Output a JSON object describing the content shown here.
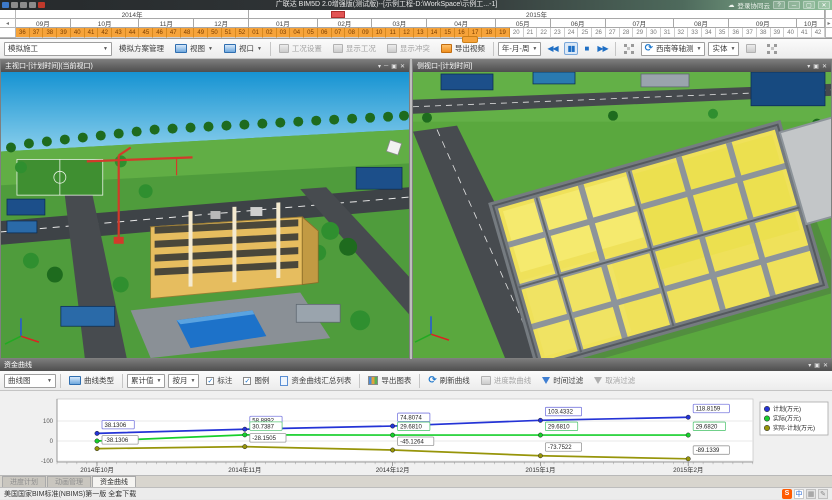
{
  "window": {
    "title": "广联达 BIM5D 2.0增强版(测试版)--[示例工程-D:\\WorkSpace\\示例工...-1]",
    "login_label": "登录协同云"
  },
  "timeline": {
    "years": [
      {
        "label": "2014年",
        "weeks": 17
      },
      {
        "label": "2015年",
        "weeks": 42
      }
    ],
    "months": [
      {
        "label": "09月",
        "weeks": 4
      },
      {
        "label": "10月",
        "weeks": 5
      },
      {
        "label": "11月",
        "weeks": 4
      },
      {
        "label": "12月",
        "weeks": 4
      },
      {
        "label": "01月",
        "weeks": 5
      },
      {
        "label": "02月",
        "weeks": 4
      },
      {
        "label": "03月",
        "weeks": 4
      },
      {
        "label": "04月",
        "weeks": 5
      },
      {
        "label": "05月",
        "weeks": 4
      },
      {
        "label": "06月",
        "weeks": 4
      },
      {
        "label": "07月",
        "weeks": 5
      },
      {
        "label": "08月",
        "weeks": 4
      },
      {
        "label": "09月",
        "weeks": 5
      },
      {
        "label": "10月",
        "weeks": 2
      }
    ],
    "weeks": [
      "36",
      "37",
      "38",
      "39",
      "40",
      "41",
      "42",
      "43",
      "44",
      "45",
      "46",
      "47",
      "48",
      "49",
      "50",
      "51",
      "52",
      "01",
      "02",
      "03",
      "04",
      "05",
      "06",
      "07",
      "08",
      "09",
      "10",
      "11",
      "12",
      "13",
      "14",
      "15",
      "16",
      "17",
      "18",
      "19",
      "20",
      "21",
      "22",
      "23",
      "24",
      "25",
      "26",
      "27",
      "28",
      "29",
      "30",
      "31",
      "32",
      "33",
      "34",
      "35",
      "36",
      "37",
      "38",
      "39",
      "40",
      "41",
      "42"
    ],
    "highlighted_count": 36,
    "current_marker_week_index": 23,
    "highlight_color": "#f6a33a"
  },
  "sim_toolbar": {
    "scheme_combo": "模拟施工",
    "manage_button": "模拟方案管理",
    "view_button": "视图",
    "viewport_button": "视口",
    "condition_button": "工况设置",
    "show_condition_button": "显示工况",
    "show_conflict_button": "显示冲突",
    "export_video_button": "导出视频",
    "granularity_combo": "年-月-周",
    "view_direction_combo": "西南等轴测",
    "display_mode_combo": "实体"
  },
  "viewports": {
    "left": {
      "title": "主视口-[计划时间](当前视口)"
    },
    "right": {
      "title": "侧视口-[计划时间]"
    }
  },
  "funds_panel": {
    "title": "资金曲线",
    "toolbar": {
      "chart_type_combo": "曲线图",
      "curve_type_button": "曲线类型",
      "value_mode_combo": "累计值",
      "period_combo": "按月",
      "annotate_checkbox": "标注",
      "legend_checkbox": "图例",
      "summary_button": "资金曲线汇总列表",
      "export_button": "导出图表",
      "refresh_button": "刷新曲线",
      "progress_curve_button": "进度款曲线",
      "time_filter_button": "时间过滤",
      "cancel_filter_button": "取消过滤"
    }
  },
  "chart_data": {
    "type": "line",
    "categories": [
      "2014年10月",
      "2014年11月",
      "2014年12月",
      "2015年1月",
      "2015年2月"
    ],
    "series": [
      {
        "name": "计划(万元)",
        "color": "#2433d6",
        "label_border": "#7a7adf",
        "values": [
          38.1306,
          58.8892,
          74.8074,
          103.4332,
          118.8159
        ],
        "labels": [
          "38.1306",
          "58.8892",
          "74.8074",
          "103.4332",
          "118.8159"
        ]
      },
      {
        "name": "实际(万元)",
        "color": "#17cf2c",
        "label_border": "#5cc97a",
        "values": [
          0,
          30.7387,
          29.681,
          29.681,
          29.682
        ],
        "labels": [
          null,
          "30.7387",
          "29.6810",
          "29.6810",
          "29.6820"
        ]
      },
      {
        "name": "实际-计划(万元)",
        "color": "#97950a",
        "label_border": "#9a9a9a",
        "values": [
          -38.1306,
          -28.1505,
          -45.1264,
          -73.7522,
          -89.1339
        ],
        "labels": [
          "-38.1306",
          "-28.1505",
          "-45.1264",
          "-73.7522",
          "-89.1339"
        ]
      }
    ],
    "yticks": [
      100,
      0,
      -100
    ],
    "ylim": [
      -130,
      170
    ],
    "grid": true,
    "legend_position": "right"
  },
  "status_bar": {
    "tabs": [
      "进度计划",
      "动画管理",
      "资金曲线"
    ],
    "active_tab": "资金曲线",
    "marquee": "美国国家BIM标准(NBIMS)第一版 全套下载",
    "tray": {
      "ime": "S",
      "lang": "中"
    }
  }
}
